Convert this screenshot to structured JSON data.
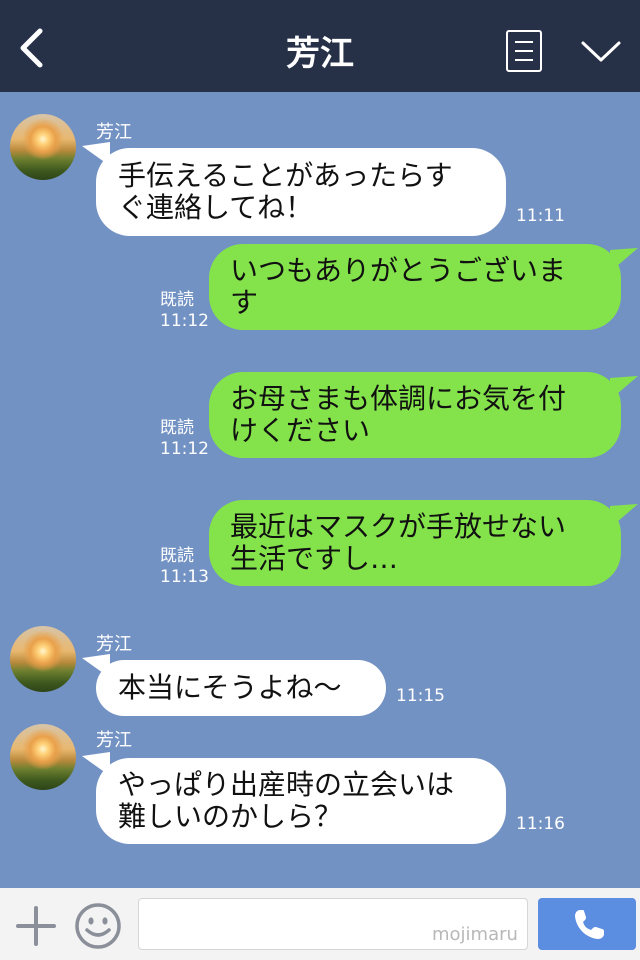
{
  "header": {
    "title": "芳江",
    "back_icon": "chevron-left-icon",
    "menu_icon": "list-icon",
    "dropdown_icon": "chevron-down-icon",
    "background": "#263148"
  },
  "chat": {
    "background": "#7392c4",
    "messages": [
      {
        "sender": "芳江",
        "side": "in",
        "lines": [
          "手伝えることがあったらす",
          "ぐ連絡してね！"
        ],
        "time": "11:11"
      },
      {
        "side": "out",
        "read": "既読",
        "lines": [
          "いつもありがとうございま",
          "す"
        ],
        "time": "11:12"
      },
      {
        "side": "out",
        "read": "既読",
        "lines": [
          "お母さまも体調にお気を付",
          "けください"
        ],
        "time": "11:12"
      },
      {
        "side": "out",
        "read": "既読",
        "lines": [
          "最近はマスクが手放せない",
          "生活ですし…"
        ],
        "time": "11:13"
      },
      {
        "sender": "芳江",
        "side": "in",
        "lines": [
          "本当にそうよね〜"
        ],
        "time": "11:15"
      },
      {
        "sender": "芳江",
        "side": "in",
        "lines": [
          "やっぱり出産時の立会いは",
          "難しいのかしら？"
        ],
        "time": "11:16"
      }
    ]
  },
  "input_bar": {
    "plus_icon": "plus-icon",
    "emoji_icon": "smile-icon",
    "watermark": "mojimaru",
    "call_icon": "phone-icon",
    "call_button_color": "#5b8de0"
  },
  "colors": {
    "incoming_bubble": "#ffffff",
    "outgoing_bubble": "#84e24b"
  }
}
